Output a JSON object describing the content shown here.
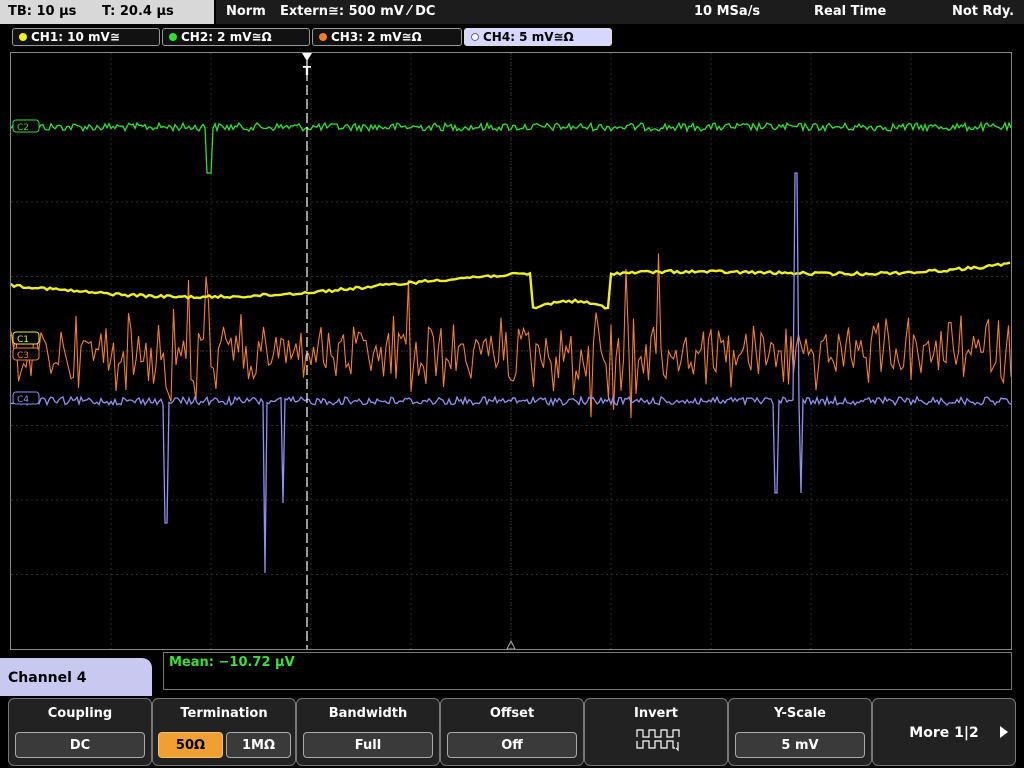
{
  "status": {
    "timebase": "TB: 10 µs",
    "trigger_time": "T: 20.4 µs",
    "trigger_mode": "Norm",
    "trigger_source": "Extern≅: 500 mV ⁄ DC",
    "sample_rate": "10 MSa/s",
    "acq_mode": "Real Time",
    "state": "Not Rdy."
  },
  "channels": [
    {
      "label": "CH1: 10 mV≅",
      "color": "#f0f020"
    },
    {
      "label": "CH2: 2 mV≅Ω",
      "color": "#30e030"
    },
    {
      "label": "CH3: 2 mV≅Ω",
      "color": "#f08030"
    },
    {
      "label": "CH4: 5 mV≅Ω",
      "color": "#9090f0"
    }
  ],
  "markers": {
    "ch1": "C1",
    "ch2": "C2",
    "ch3": "C3",
    "ch4": "C4",
    "trigger": "T"
  },
  "measurement": "Mean: −10.72 µV",
  "menu": {
    "title": "Channel 4",
    "coupling": {
      "title": "Coupling",
      "value": "DC"
    },
    "termination": {
      "title": "Termination",
      "options": [
        "50Ω",
        "1MΩ"
      ],
      "selected": "50Ω"
    },
    "bandwidth": {
      "title": "Bandwidth",
      "value": "Full"
    },
    "offset": {
      "title": "Offset",
      "value": "Off"
    },
    "invert": {
      "title": "Invert",
      "icon": "invert-waveform-icon"
    },
    "yscale": {
      "title": "Y-Scale",
      "value": "5 mV"
    },
    "more": {
      "label": "More 1|2"
    }
  }
}
